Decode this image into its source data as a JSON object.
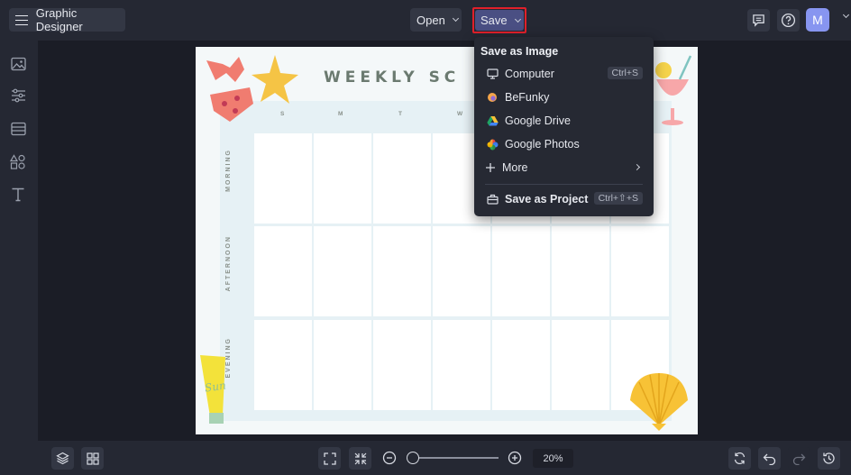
{
  "app": {
    "title": "Graphic Designer"
  },
  "toolbar": {
    "open_label": "Open",
    "save_label": "Save",
    "avatar_initial": "M"
  },
  "sidebar": {
    "items": [
      "image-icon",
      "adjust-icon",
      "layout-icon",
      "elements-icon",
      "text-icon"
    ]
  },
  "save_menu": {
    "heading": "Save as Image",
    "items": [
      {
        "label": "Computer",
        "icon": "monitor-icon",
        "shortcut": "Ctrl+S"
      },
      {
        "label": "BeFunky",
        "icon": "befunky-icon"
      },
      {
        "label": "Google Drive",
        "icon": "google-drive-icon"
      },
      {
        "label": "Google Photos",
        "icon": "google-photos-icon"
      },
      {
        "label": "More",
        "icon": "plus-icon"
      }
    ],
    "project": {
      "label": "Save as Project",
      "icon": "briefcase-icon",
      "shortcut": "Ctrl+⇧+S"
    }
  },
  "canvas": {
    "title": "WEEKLY SC",
    "days": [
      "S",
      "M",
      "T",
      "W"
    ],
    "rows": [
      "MORNING",
      "AFTERNOON",
      "EVENING"
    ],
    "sunscreen_text": "Sun"
  },
  "zoom": {
    "value": "20%",
    "level_percent": 20
  },
  "colors": {
    "accent": "#4a4f83",
    "highlight": "#e0202a",
    "avatar": "#8795f0"
  }
}
